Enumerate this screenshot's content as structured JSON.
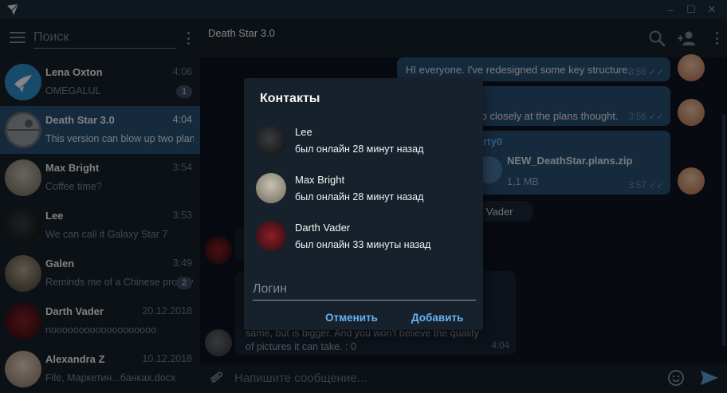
{
  "window": {
    "logo_icon": "paper-plane-icon",
    "controls": {
      "minimize": "–",
      "maximize": "☐",
      "close": "✕"
    }
  },
  "sidebar": {
    "search_placeholder": "Поиск",
    "chats": [
      {
        "name": "Lena Oxton",
        "time": "4:06",
        "message": "OMEGALUL",
        "badge": "1",
        "active": false
      },
      {
        "name": "Death Star 3.0",
        "time": "4:04",
        "message": "This version can blow up two planets",
        "badge": "",
        "active": true
      },
      {
        "name": "Max Bright",
        "time": "3:54",
        "message": "Coffee time?",
        "badge": "",
        "active": false
      },
      {
        "name": "Lee",
        "time": "3:53",
        "message": "We can call it Galaxy Star 7",
        "badge": "",
        "active": false
      },
      {
        "name": "Galen",
        "time": "3:49",
        "message": "Reminds me of a Chinese prototype",
        "badge": "2",
        "active": false
      },
      {
        "name": "Darth Vader",
        "time": "20.12.2018",
        "message": "nooooooooooooooooooo",
        "badge": "",
        "active": false
      },
      {
        "name": "Alexandra Z",
        "time": "10.12.2018",
        "message": "File, Маркетин...банках.docx",
        "badge": "",
        "active": false
      }
    ]
  },
  "conversation": {
    "title": "Death Star 3.0",
    "messages": {
      "m1_text": "HI everyone. I've redesigned some key structure.",
      "m1_time": "3:56",
      "m2_text": "to closely at the plans thought.",
      "m2_time": "3:56",
      "file_sender": "erty0",
      "file_name": "NEW_DeathStar.plans.zip",
      "file_size": "1,1 MB",
      "file_time": "3:57",
      "service_text": "rth Vader",
      "last_line1": "same, but is bigger. And you won't believe the quality",
      "last_line2": "of pictures it can take. : 0",
      "last_time": "4:04"
    },
    "composer_placeholder": "Напишите сообщение..."
  },
  "dialog": {
    "title": "Контакты",
    "contacts": [
      {
        "name": "Lee",
        "status": "был онлайн 28 минут назад"
      },
      {
        "name": "Max Bright",
        "status": "был онлайн 28 минут назад"
      },
      {
        "name": "Darth Vader",
        "status": "был онлайн 33 минуты назад"
      }
    ],
    "login_placeholder": "Логин",
    "cancel_label": "Отменить",
    "add_label": "Добавить"
  },
  "colors": {
    "accent": "#64b2f2",
    "active_chat": "#2b5278",
    "panel": "#17212b",
    "chat_bg": "#0e1621"
  }
}
